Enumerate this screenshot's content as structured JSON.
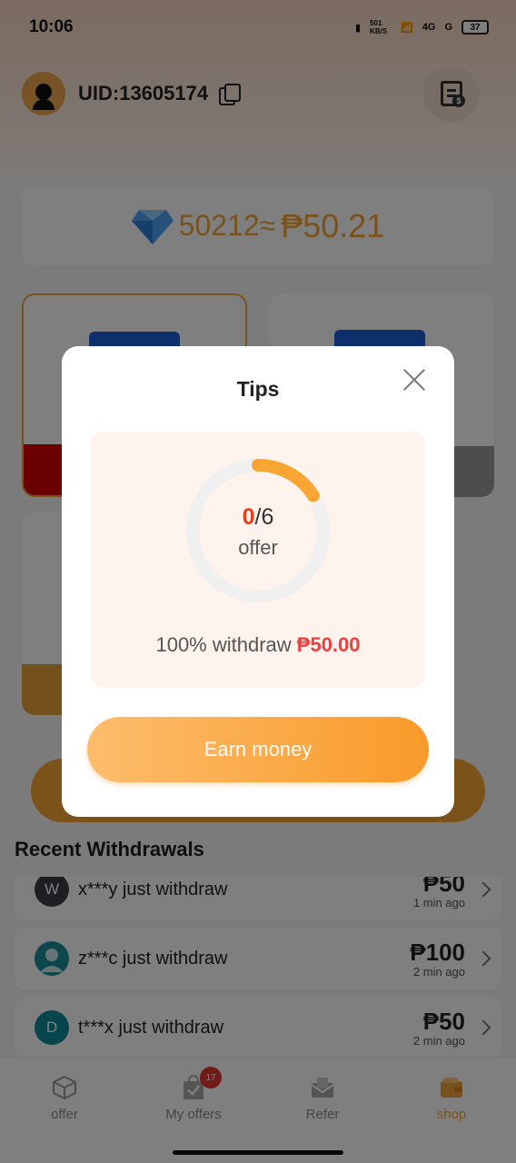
{
  "status_bar": {
    "time": "10:06",
    "net_speed": "501 KB/S",
    "net_1": "4G",
    "net_2": "G",
    "battery": "37"
  },
  "header": {
    "uid": "UID:13605174"
  },
  "balance": {
    "text": "50212≈",
    "peso": "₱50.21"
  },
  "recent": {
    "title": "Recent Withdrawals",
    "items": [
      {
        "initial": "W",
        "text": "x***y just withdraw",
        "amount": "₱50",
        "time": "1 min ago",
        "color": "#3a3f46"
      },
      {
        "initial": "",
        "text": "z***c just withdraw",
        "amount": "₱100",
        "time": "2 min ago",
        "color": "#1a8e99"
      },
      {
        "initial": "D",
        "text": "t***x just withdraw",
        "amount": "₱50",
        "time": "2 min ago",
        "color": "#0f8b98"
      }
    ]
  },
  "tabbar": {
    "tabs": [
      {
        "label": "offer",
        "icon": "cube-icon"
      },
      {
        "label": "My offers",
        "icon": "bag-check-icon",
        "badge": "17"
      },
      {
        "label": "Refer",
        "icon": "mail-icon"
      },
      {
        "label": "shop",
        "icon": "wallet-icon"
      }
    ],
    "active": "shop"
  },
  "modal": {
    "title": "Tips",
    "progress": {
      "current": "0",
      "separator": "/6",
      "total": 6,
      "label": "offer",
      "arc_fraction": 0.16
    },
    "withdraw_prefix": "100% withdraw ",
    "withdraw_amount": "₱50.00",
    "button": "Earn money"
  },
  "colors": {
    "accent": "#f6a734",
    "highlight_red": "#ee3f1c",
    "card_band_1": "#d40000",
    "card_band_2": "#9b9b9b",
    "card_band_3": "#e8a13a"
  }
}
